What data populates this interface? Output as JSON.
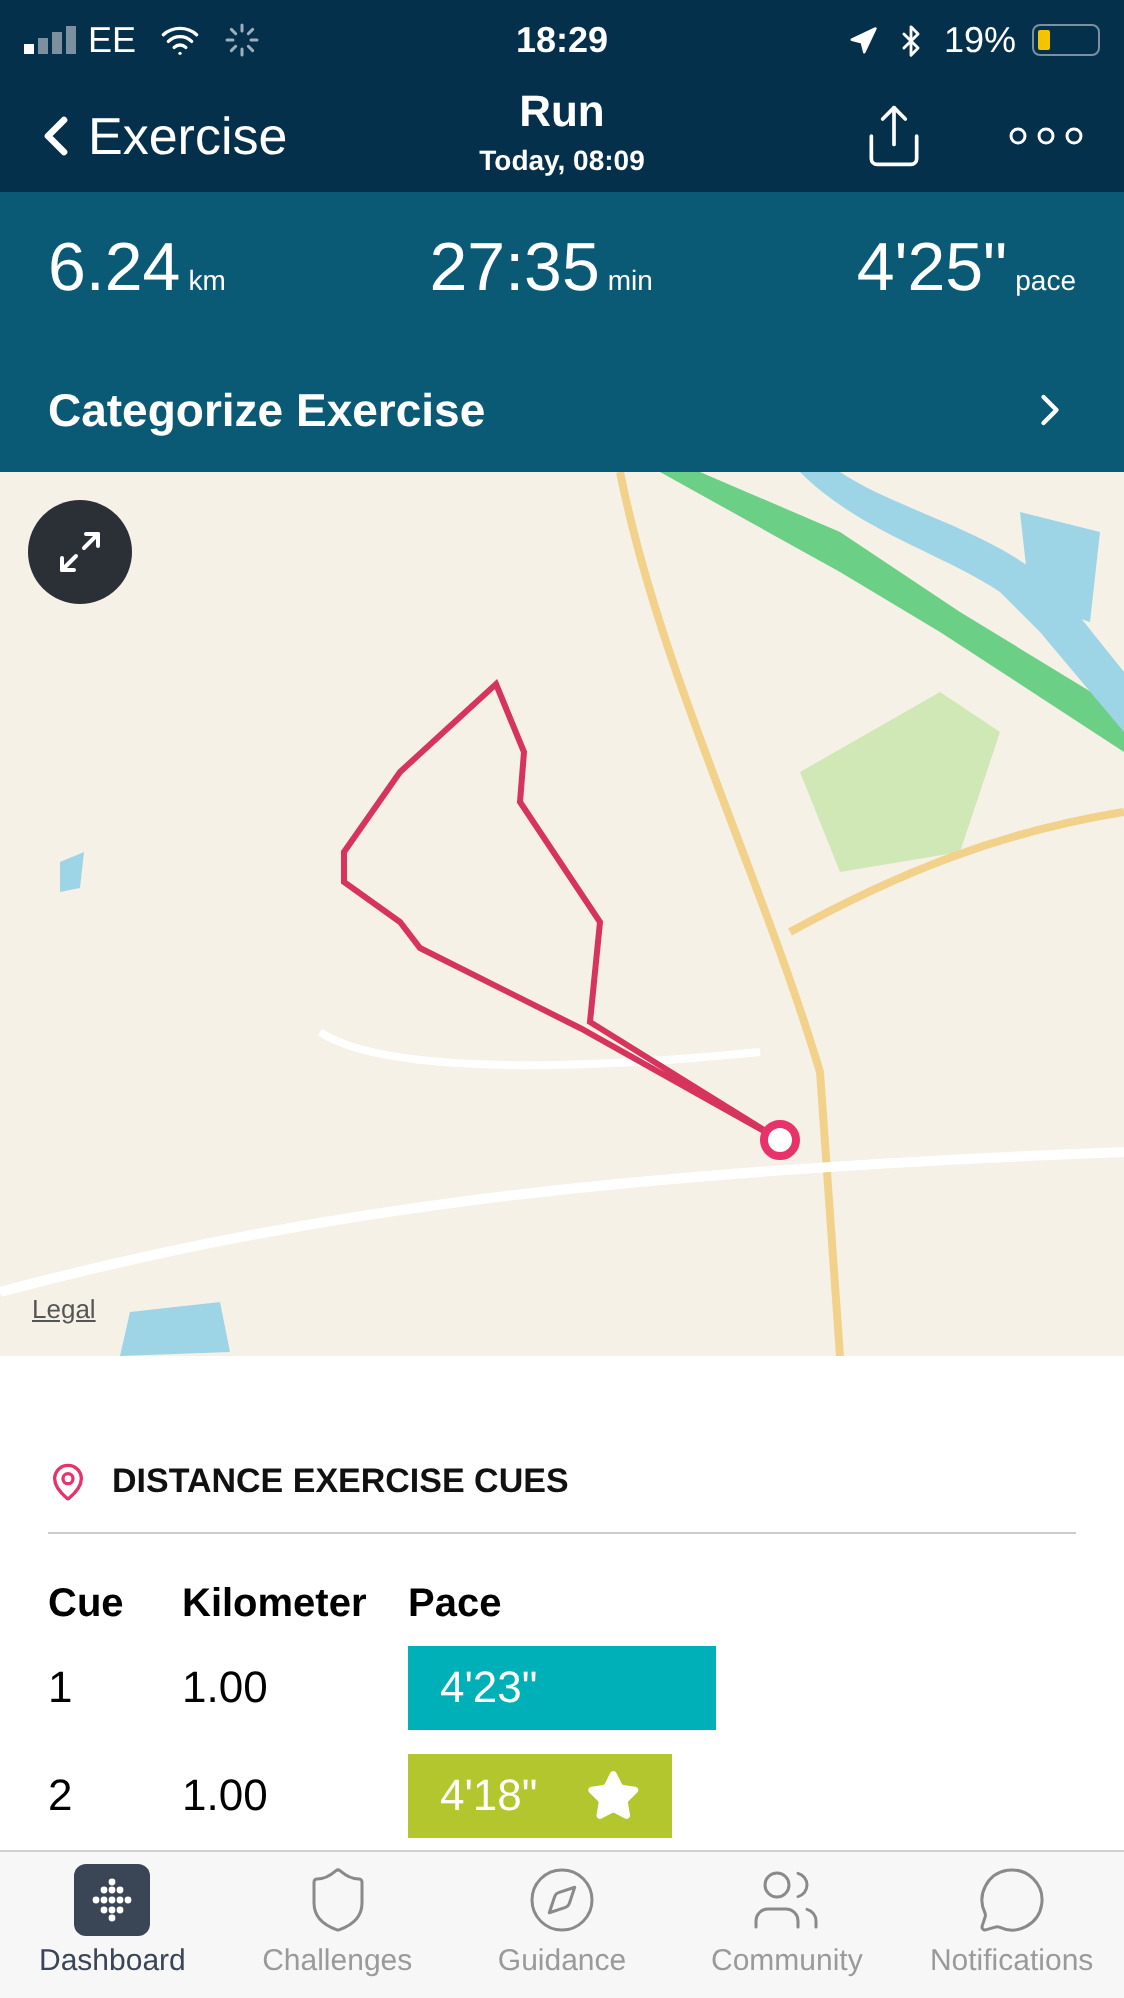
{
  "status_bar": {
    "carrier": "EE",
    "time": "18:29",
    "battery": "19%"
  },
  "nav": {
    "back": "Exercise",
    "title": "Run",
    "subtitle": "Today, 08:09"
  },
  "stats": [
    {
      "value": "6.24",
      "unit": "km"
    },
    {
      "value": "27:35",
      "unit": "min"
    },
    {
      "value": "4'25\"",
      "unit": "pace"
    }
  ],
  "categorize": "Categorize Exercise",
  "map": {
    "kind": "picture",
    "legal": "Legal"
  },
  "cues": {
    "title": "DISTANCE EXERCISE CUES",
    "columns": [
      "Cue",
      "Kilometer",
      "Pace"
    ],
    "rows": [
      {
        "cue": "1",
        "km": "1.00",
        "pace": "4'23\"",
        "color": "#00b0b9",
        "best": false
      },
      {
        "cue": "2",
        "km": "1.00",
        "pace": "4'18\"",
        "color": "#b4c62e",
        "best": true
      }
    ]
  },
  "tabs": [
    {
      "label": "Dashboard",
      "selected": true,
      "kind": "dashboard"
    },
    {
      "label": "Challenges",
      "selected": false,
      "kind": "challenges"
    },
    {
      "label": "Guidance",
      "selected": false,
      "kind": "guidance"
    },
    {
      "label": "Community",
      "selected": false,
      "kind": "community"
    },
    {
      "label": "Notifications",
      "selected": false,
      "kind": "notifications"
    }
  ]
}
